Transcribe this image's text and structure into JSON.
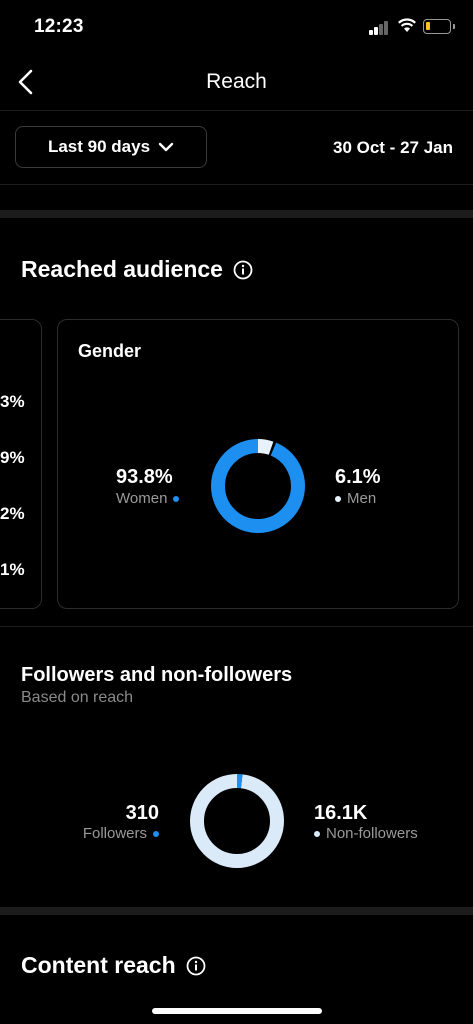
{
  "status_bar": {
    "time": "12:23"
  },
  "header": {
    "title": "Reach"
  },
  "range": {
    "selector_label": "Last 90 days",
    "dates": "30 Oct - 27 Jan"
  },
  "reached_audience": {
    "title": "Reached audience",
    "left_card_values": [
      "3%",
      "9%",
      "2%",
      "1%"
    ],
    "gender": {
      "title": "Gender",
      "women_value": "93.8%",
      "women_label": "Women",
      "men_value": "6.1%",
      "men_label": "Men",
      "women_fraction": 0.938,
      "men_fraction": 0.061,
      "colors": {
        "women": "#1c8ff0",
        "men": "#e8f2fc"
      }
    }
  },
  "followers": {
    "title": "Followers and non-followers",
    "subtitle": "Based on reach",
    "followers_value": "310",
    "followers_label": "Followers",
    "nonfollowers_value": "16.1K",
    "nonfollowers_label": "Non-followers",
    "followers_fraction": 0.019,
    "colors": {
      "followers": "#1c8ff0",
      "nonfollowers": "#dbeaf8"
    }
  },
  "content_reach": {
    "title": "Content reach"
  }
}
